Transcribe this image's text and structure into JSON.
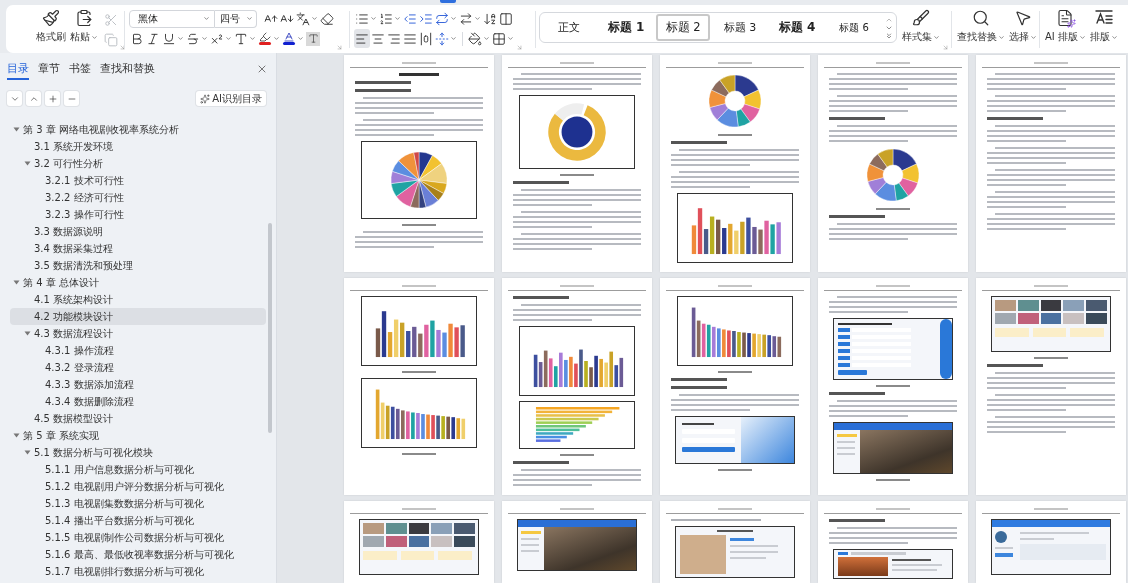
{
  "ribbon": {
    "clipboard": [
      {
        "kind": "format-painter",
        "label": "格式刷"
      },
      {
        "kind": "paste",
        "label": "粘贴"
      }
    ],
    "edit_tools": [
      {
        "kind": "cut",
        "disabled": true
      },
      {
        "kind": "copy",
        "disabled": true
      }
    ],
    "font_family": "黑体",
    "font_size": "四号",
    "alignment": [
      {
        "kind": "left",
        "selected": true
      },
      {
        "kind": "center",
        "selected": false
      },
      {
        "kind": "right",
        "selected": false
      },
      {
        "kind": "justify",
        "selected": false
      },
      {
        "kind": "distributed",
        "selected": false
      }
    ],
    "styles": [
      {
        "kind": "body",
        "label": "正文",
        "selected": false
      },
      {
        "kind": "heading1",
        "label": "标题 1",
        "selected": false
      },
      {
        "kind": "heading2",
        "label": "标题 2",
        "selected": true
      },
      {
        "kind": "heading3",
        "label": "标题 3",
        "selected": false
      },
      {
        "kind": "heading4",
        "label": "标题 4",
        "selected": false
      },
      {
        "kind": "heading6",
        "label": "标题 6",
        "selected": false
      }
    ],
    "tools": [
      {
        "kind": "style-set",
        "label": "样式集"
      },
      {
        "kind": "find-replace",
        "label": "查找替换"
      },
      {
        "kind": "select",
        "label": "选择"
      },
      {
        "kind": "ai-layout",
        "label": "AI 排版"
      },
      {
        "kind": "layout",
        "label": "排版"
      }
    ]
  },
  "sidebar": {
    "tabs": [
      {
        "label": "目录",
        "selected": true
      },
      {
        "label": "章节",
        "selected": false
      },
      {
        "label": "书签",
        "selected": false
      },
      {
        "label": "查找和替换",
        "selected": false
      }
    ],
    "ai_button": "AI识别目录",
    "outline": [
      {
        "label": "第 3 章 网络电视剧收视率系统分析",
        "selected": false,
        "expanded": true,
        "children": [
          {
            "label": "3.1 系统开发环境",
            "selected": false
          },
          {
            "label": "3.2 可行性分析",
            "selected": false,
            "expanded": true,
            "children": [
              {
                "label": "3.2.1 技术可行性",
                "selected": false
              },
              {
                "label": "3.2.2 经济可行性",
                "selected": false
              },
              {
                "label": "3.2.3 操作可行性",
                "selected": false
              }
            ]
          },
          {
            "label": "3.3 数据源说明",
            "selected": false
          },
          {
            "label": "3.4 数据采集过程",
            "selected": false
          },
          {
            "label": "3.5 数据清洗和预处理",
            "selected": false
          }
        ]
      },
      {
        "label": "第 4 章 总体设计",
        "selected": false,
        "expanded": true,
        "children": [
          {
            "label": "4.1 系统架构设计",
            "selected": false
          },
          {
            "label": "4.2 功能模块设计",
            "selected": true
          },
          {
            "label": "4.3 数据流程设计",
            "selected": false,
            "expanded": true,
            "children": [
              {
                "label": "4.3.1 操作流程",
                "selected": false
              },
              {
                "label": "4.3.2 登录流程",
                "selected": false
              },
              {
                "label": "4.3.3 数据添加流程",
                "selected": false
              },
              {
                "label": "4.3.4 数据删除流程",
                "selected": false
              }
            ]
          },
          {
            "label": "4.5 数据模型设计",
            "selected": false
          }
        ]
      },
      {
        "label": "第 5 章 系统实现",
        "selected": false,
        "expanded": true,
        "children": [
          {
            "label": "5.1 数据分析与可视化模块",
            "selected": false,
            "expanded": true,
            "children": [
              {
                "label": "5.1.1 用户信息数据分析与可视化",
                "selected": false
              },
              {
                "label": "5.1.2 电视剧用户评分数据分析与可视化",
                "selected": false
              },
              {
                "label": "5.1.3 电视剧集数数据分析与可视化",
                "selected": false
              },
              {
                "label": "5.1.4 播出平台数据分析与可视化",
                "selected": false
              },
              {
                "label": "5.1.5 电视剧制作公司数据分析与可视化",
                "selected": false
              },
              {
                "label": "5.1.6 最高、最低收视率数据分析与可视化",
                "selected": false
              },
              {
                "label": "5.1.7 电视剧排行数据分析与可视化",
                "selected": false
              }
            ]
          }
        ]
      }
    ]
  },
  "document": {
    "pages": [
      {
        "blocks": [
          {
            "kind": "title"
          },
          {
            "kind": "heading"
          },
          {
            "kind": "heading"
          },
          {
            "kind": "text"
          },
          {
            "kind": "text"
          },
          {
            "kind": "pie"
          },
          {
            "kind": "caption"
          },
          {
            "kind": "text"
          }
        ]
      },
      {
        "blocks": [
          {
            "kind": "text"
          },
          {
            "kind": "donut"
          },
          {
            "kind": "caption"
          },
          {
            "kind": "heading"
          },
          {
            "kind": "text"
          },
          {
            "kind": "text"
          },
          {
            "kind": "text"
          }
        ]
      },
      {
        "blocks": [
          {
            "kind": "ring"
          },
          {
            "kind": "caption"
          },
          {
            "kind": "heading"
          },
          {
            "kind": "text"
          },
          {
            "kind": "text"
          },
          {
            "kind": "bars"
          }
        ]
      },
      {
        "blocks": [
          {
            "kind": "text"
          },
          {
            "kind": "text"
          },
          {
            "kind": "heading"
          },
          {
            "kind": "text"
          },
          {
            "kind": "ring"
          },
          {
            "kind": "caption"
          },
          {
            "kind": "heading"
          },
          {
            "kind": "text"
          }
        ]
      },
      {
        "blocks": [
          {
            "kind": "text"
          },
          {
            "kind": "text"
          },
          {
            "kind": "heading"
          },
          {
            "kind": "text"
          },
          {
            "kind": "text"
          },
          {
            "kind": "text"
          },
          {
            "kind": "text"
          },
          {
            "kind": "text"
          }
        ]
      },
      {
        "blocks": [
          {
            "kind": "bars"
          },
          {
            "kind": "caption"
          },
          {
            "kind": "bars"
          },
          {
            "kind": "caption"
          }
        ]
      },
      {
        "blocks": [
          {
            "kind": "heading"
          },
          {
            "kind": "text"
          },
          {
            "kind": "bars"
          },
          {
            "kind": "hbars"
          },
          {
            "kind": "caption"
          },
          {
            "kind": "heading"
          },
          {
            "kind": "text"
          }
        ]
      },
      {
        "blocks": [
          {
            "kind": "bars"
          },
          {
            "kind": "caption"
          },
          {
            "kind": "heading"
          },
          {
            "kind": "heading"
          },
          {
            "kind": "text"
          },
          {
            "kind": "login"
          },
          {
            "kind": "caption"
          }
        ]
      },
      {
        "blocks": [
          {
            "kind": "text"
          },
          {
            "kind": "form"
          },
          {
            "kind": "caption"
          },
          {
            "kind": "heading"
          },
          {
            "kind": "text"
          },
          {
            "kind": "banner"
          },
          {
            "kind": "caption"
          }
        ]
      },
      {
        "blocks": [
          {
            "kind": "gallery"
          },
          {
            "kind": "caption"
          },
          {
            "kind": "heading"
          },
          {
            "kind": "text"
          },
          {
            "kind": "text"
          },
          {
            "kind": "text"
          }
        ]
      },
      {
        "blocks": [
          {
            "kind": "gallery"
          }
        ]
      },
      {
        "blocks": [
          {
            "kind": "banner"
          }
        ]
      },
      {
        "blocks": [
          {
            "kind": "line"
          },
          {
            "kind": "portrait"
          }
        ]
      },
      {
        "blocks": [
          {
            "kind": "heading"
          },
          {
            "kind": "text"
          },
          {
            "kind": "poster"
          }
        ]
      },
      {
        "blocks": [
          {
            "kind": "profile"
          }
        ]
      }
    ]
  }
}
